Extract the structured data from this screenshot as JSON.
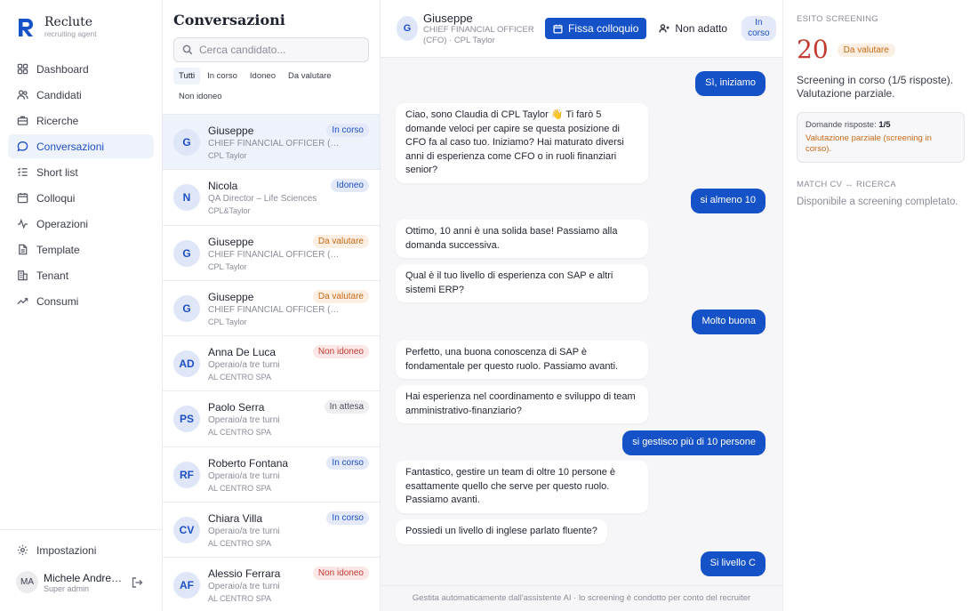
{
  "brand": {
    "name": "Reclute",
    "subtitle": "recruiting agent",
    "logo_letter": "R"
  },
  "sidebar": {
    "items": [
      {
        "label": "Dashboard",
        "icon": "grid-icon"
      },
      {
        "label": "Candidati",
        "icon": "users-icon"
      },
      {
        "label": "Ricerche",
        "icon": "briefcase-icon"
      },
      {
        "label": "Conversazioni",
        "icon": "chat-icon",
        "active": true
      },
      {
        "label": "Short list",
        "icon": "checklist-icon"
      },
      {
        "label": "Colloqui",
        "icon": "calendar-icon"
      },
      {
        "label": "Operazioni",
        "icon": "activity-icon"
      },
      {
        "label": "Template",
        "icon": "document-icon"
      },
      {
        "label": "Tenant",
        "icon": "building-icon"
      },
      {
        "label": "Consumi",
        "icon": "trend-icon"
      }
    ],
    "settings_label": "Impostazioni",
    "user": {
      "initials": "MA",
      "name": "Michele Andrea...",
      "role": "Super admin"
    }
  },
  "conversations": {
    "title": "Conversazioni",
    "search_placeholder": "Cerca candidato...",
    "filters": [
      "Tutti",
      "In corso",
      "Idoneo",
      "Da valutare",
      "Non idoneo"
    ],
    "items": [
      {
        "initials": "G",
        "name": "Giuseppe",
        "role": "CHIEF FINANCIAL OFFICER (CFO)",
        "company": "CPL Taylor",
        "status": "In corso",
        "tone": "blue"
      },
      {
        "initials": "N",
        "name": "Nicola",
        "role": "QA Director – Life Sciences",
        "company": "CPL&Taylor",
        "status": "Idoneo",
        "tone": "blue"
      },
      {
        "initials": "G",
        "name": "Giuseppe",
        "role": "CHIEF FINANCIAL OFFICER (CFO)",
        "company": "CPL Taylor",
        "status": "Da valutare",
        "tone": "orange"
      },
      {
        "initials": "G",
        "name": "Giuseppe",
        "role": "CHIEF FINANCIAL OFFICER (CFO)",
        "company": "CPL Taylor",
        "status": "Da valutare",
        "tone": "orange"
      },
      {
        "initials": "AD",
        "name": "Anna De Luca",
        "role": "Operaio/a tre turni",
        "company": "AL CENTRO SPA",
        "status": "Non idoneo",
        "tone": "red"
      },
      {
        "initials": "PS",
        "name": "Paolo Serra",
        "role": "Operaio/a tre turni",
        "company": "AL CENTRO SPA",
        "status": "In attesa",
        "tone": "gray"
      },
      {
        "initials": "RF",
        "name": "Roberto Fontana",
        "role": "Operaio/a tre turni",
        "company": "AL CENTRO SPA",
        "status": "In corso",
        "tone": "blue"
      },
      {
        "initials": "CV",
        "name": "Chiara Villa",
        "role": "Operaio/a tre turni",
        "company": "AL CENTRO SPA",
        "status": "In corso",
        "tone": "blue"
      },
      {
        "initials": "AF",
        "name": "Alessio Ferrara",
        "role": "Operaio/a tre turni",
        "company": "AL CENTRO SPA",
        "status": "Non idoneo",
        "tone": "red"
      }
    ]
  },
  "chat": {
    "header": {
      "initials": "G",
      "name": "Giuseppe",
      "role": "CHIEF FINANCIAL OFFICER (CFO) · CPL Taylor",
      "schedule_label": "Fissa colloquio",
      "reject_label": "Non adatto",
      "status": "In corso"
    },
    "messages": [
      {
        "from": "candidate",
        "text": "Sì, iniziamo"
      },
      {
        "from": "agent",
        "text": "Ciao, sono Claudia di CPL Taylor 👋 Ti farò 5 domande veloci per capire se questa posizione di CFO fa al caso tuo. Iniziamo? Hai maturato diversi anni di esperienza come CFO o in ruoli finanziari senior?"
      },
      {
        "from": "candidate",
        "text": "si almeno 10"
      },
      {
        "from": "agent",
        "text": "Ottimo, 10 anni è una solida base! Passiamo alla domanda successiva."
      },
      {
        "from": "agent",
        "text": "Qual è il tuo livello di esperienza con SAP e altri sistemi ERP?"
      },
      {
        "from": "candidate",
        "text": "Molto buona"
      },
      {
        "from": "agent",
        "text": "Perfetto, una buona conoscenza di SAP è fondamentale per questo ruolo. Passiamo avanti."
      },
      {
        "from": "agent",
        "text": "Hai esperienza nel coordinamento e sviluppo di team amministrativo-finanziario?"
      },
      {
        "from": "candidate",
        "text": "si gestisco più di 10 persone"
      },
      {
        "from": "agent",
        "text": "Fantastico, gestire un team di oltre 10 persone è esattamente quello che serve per questo ruolo. Passiamo avanti."
      },
      {
        "from": "agent",
        "text": "Possiedi un livello di inglese parlato fluente?"
      },
      {
        "from": "candidate",
        "text": "Si livello C"
      }
    ],
    "footer": "Gestita automaticamente dall'assistente AI · lo screening è condotto per conto del recruiter"
  },
  "result": {
    "label": "Esito screening",
    "score": "20",
    "score_badge": "Da valutare",
    "description": "Screening in corso (1/5 risposte). Valutazione parziale.",
    "answers_label": "Domande risposte:",
    "answers_value": "1/5",
    "warning": "Valutazione parziale (screening in corso).",
    "match_label": "Match CV ↔ Ricerca",
    "match_description": "Disponibile a screening completato."
  },
  "colors": {
    "accent": "#1552c8",
    "score": "#c33a31",
    "warning": "#c76a16"
  }
}
